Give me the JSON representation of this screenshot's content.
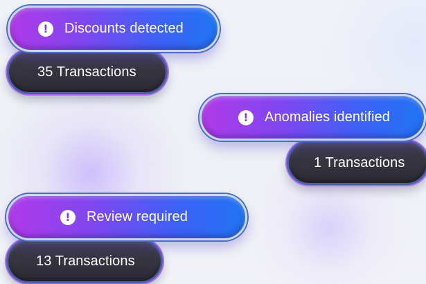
{
  "colors": {
    "alert_gradient_start": "#b13ae9",
    "alert_gradient_end": "#1f74f3",
    "count_pill_bg": "#35333e",
    "text": "#ffffff"
  },
  "icons": {
    "alert": "exclamation-circle-icon",
    "alert_glyph": "!"
  },
  "alerts": [
    {
      "label": "Discounts detected",
      "count": "35 Transactions"
    },
    {
      "label": "Anomalies identified",
      "count": "1 Transactions"
    },
    {
      "label": "Review required",
      "count": "13 Transactions"
    }
  ]
}
